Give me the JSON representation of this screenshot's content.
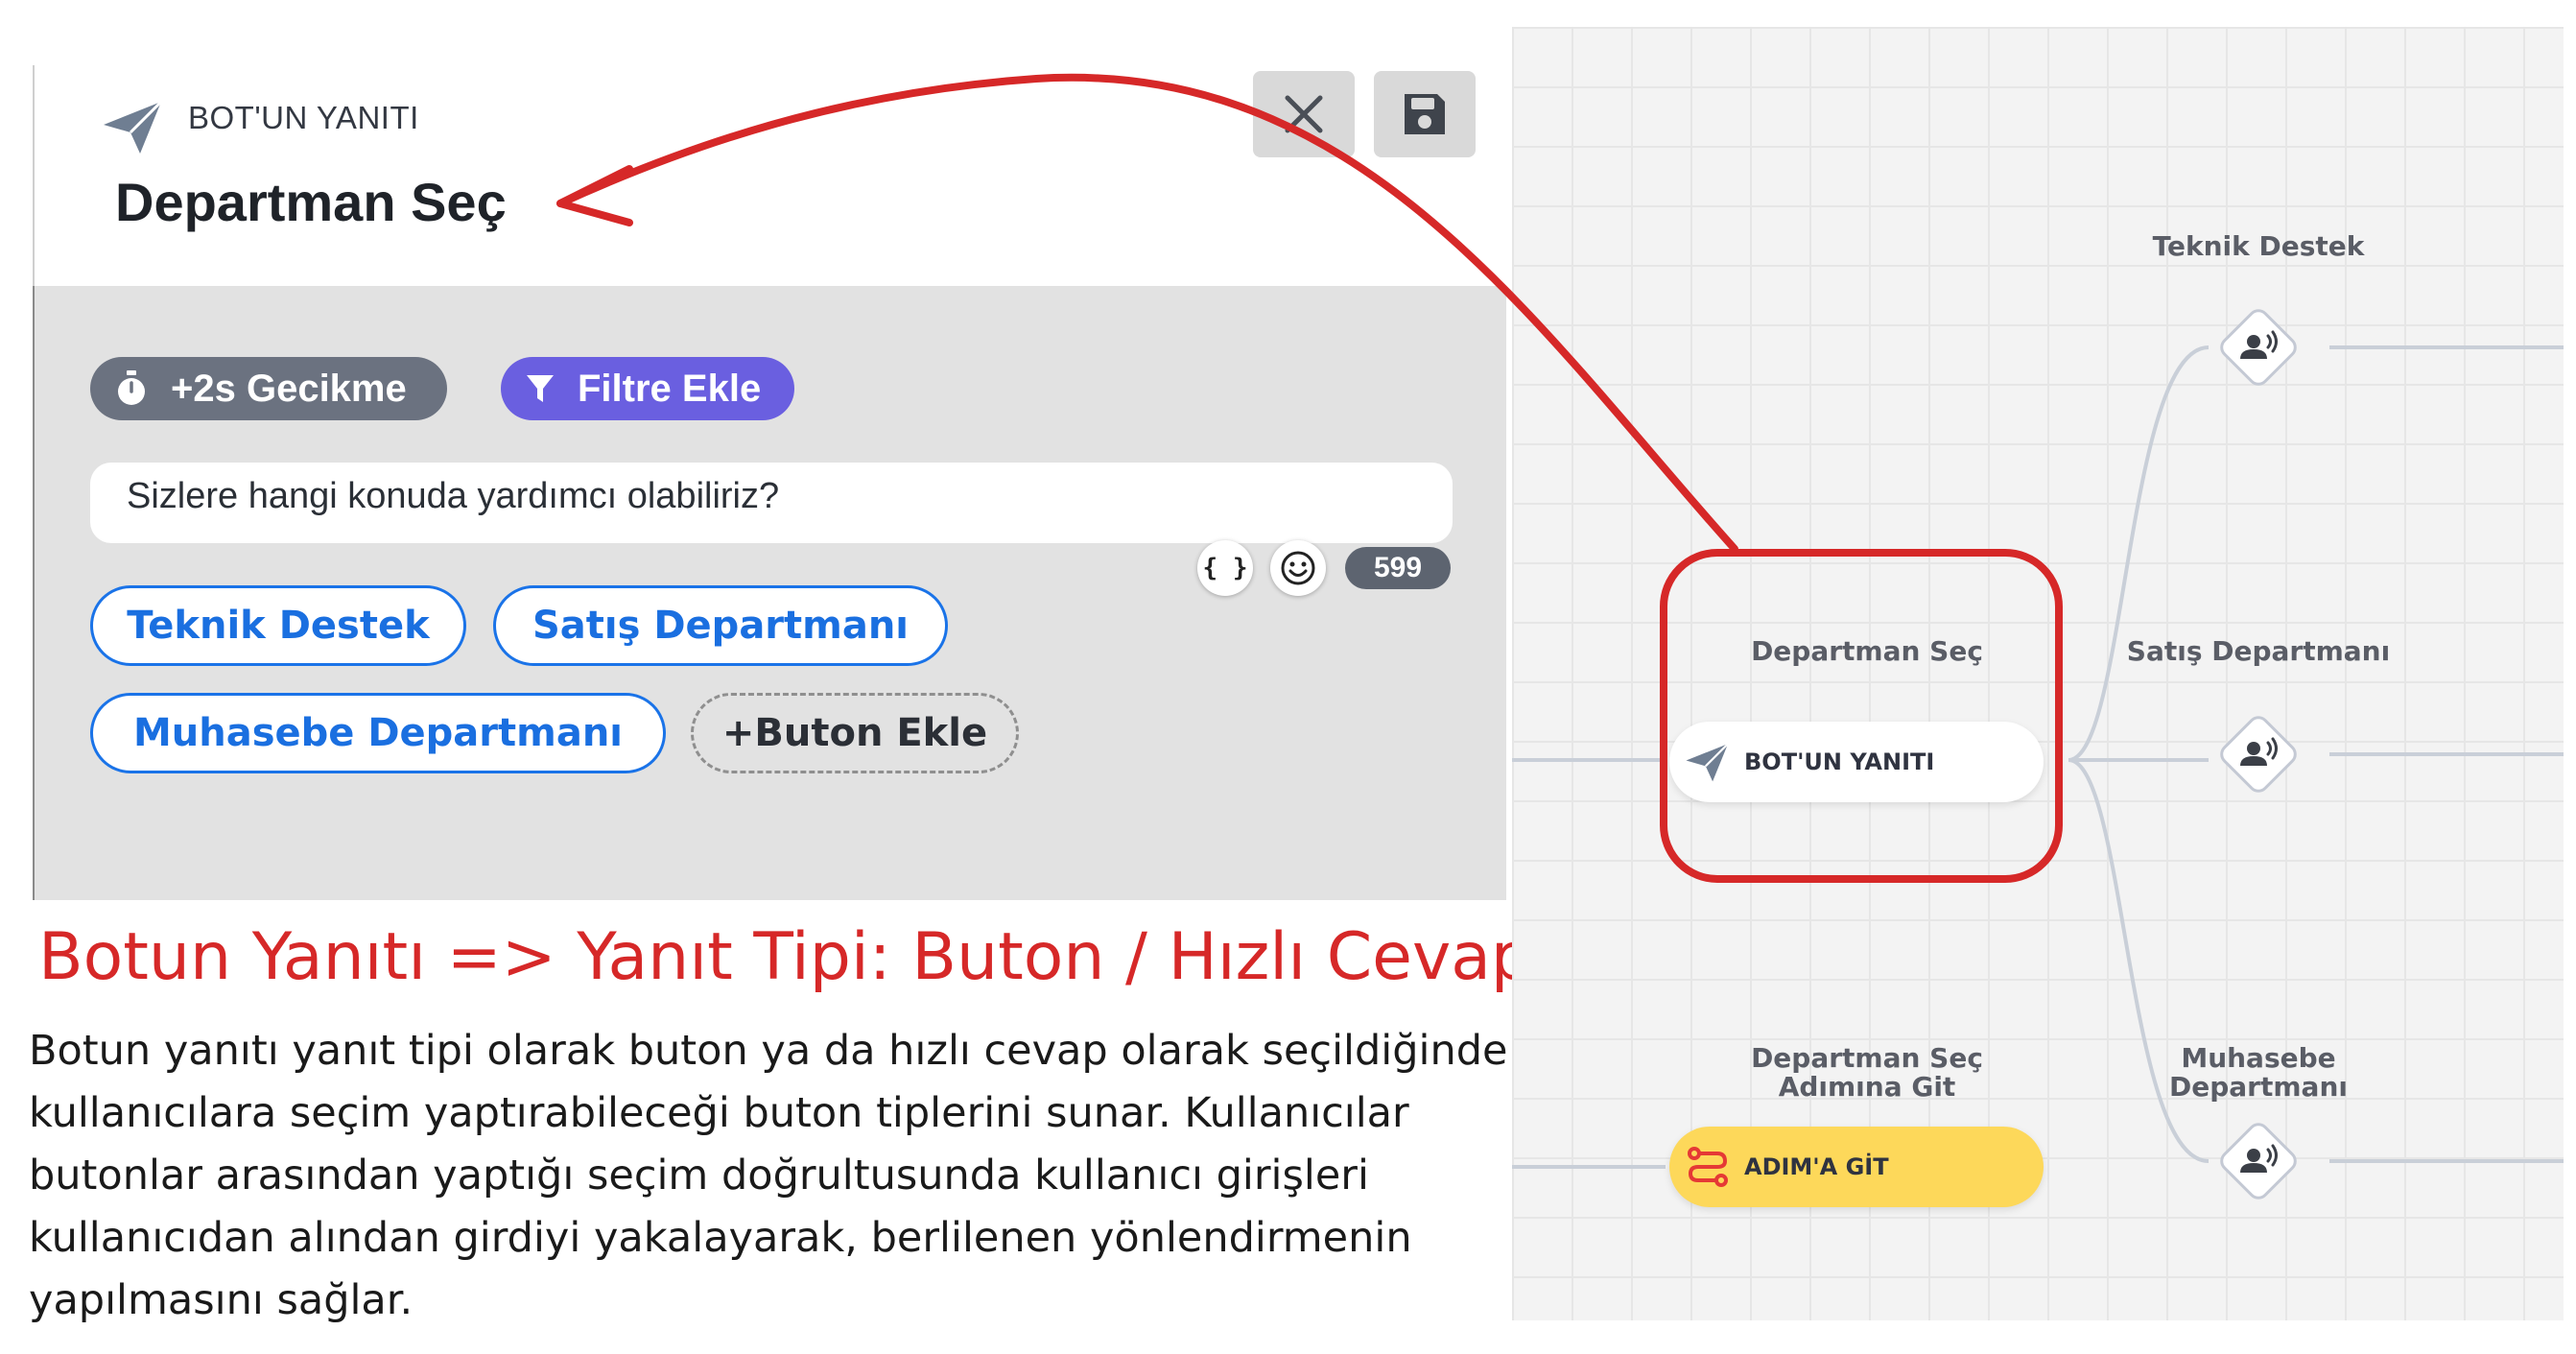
{
  "editor": {
    "header_subtitle": "BOT'UN YANITI",
    "header_title": "Departman Seç",
    "icons": [
      "send-icon",
      "close-icon",
      "save-icon"
    ],
    "delay_chip": "+2s Gecikme",
    "filter_chip": "Filtre Ekle",
    "message_text": "Sizlere hangi konuda yardımcı olabiliriz?",
    "variable_icon_glyph": "{ }",
    "char_count": "599",
    "reply_buttons": [
      "Teknik Destek",
      "Satış Departmanı",
      "Muhasebe Departmanı"
    ],
    "add_button": "+Buton Ekle"
  },
  "caption": {
    "title": "Botun Yanıtı => Yanıt Tipi: Buton / Hızlı Cevap",
    "body_lines": [
      "Botun yanıtı yanıt tipi olarak buton ya da hızlı cevap olarak seçildiğinde",
      "kullanıcılara seçim yaptırabileceği buton tiplerini sunar. Kullanıcılar",
      "butonlar arasından yaptığı seçim doğrultusunda kullanıcı girişleri",
      "kullanıcıdan alından girdiyi yakalayarak, berlilenen yönlendirmenin",
      "yapılmasını sağlar."
    ]
  },
  "flow": {
    "node_title": "Departman Seç",
    "node_type": "BOT'UN YANITI",
    "goto_title_lines": [
      "Departman Seç",
      "Adımına Git"
    ],
    "goto_label": "ADIM'A GİT",
    "branches": [
      {
        "label_lines": [
          "Teknik Destek"
        ]
      },
      {
        "label_lines": [
          "Satış Departmanı"
        ]
      },
      {
        "label_lines": [
          "Muhasebe",
          "Departmanı"
        ]
      }
    ],
    "colors": {
      "highlight": "#d62828",
      "goto_node": "#fdd85a",
      "reply_button_border": "#1a73e8",
      "filter_chip": "#6a5fe0",
      "delay_chip": "#6b7280"
    }
  }
}
